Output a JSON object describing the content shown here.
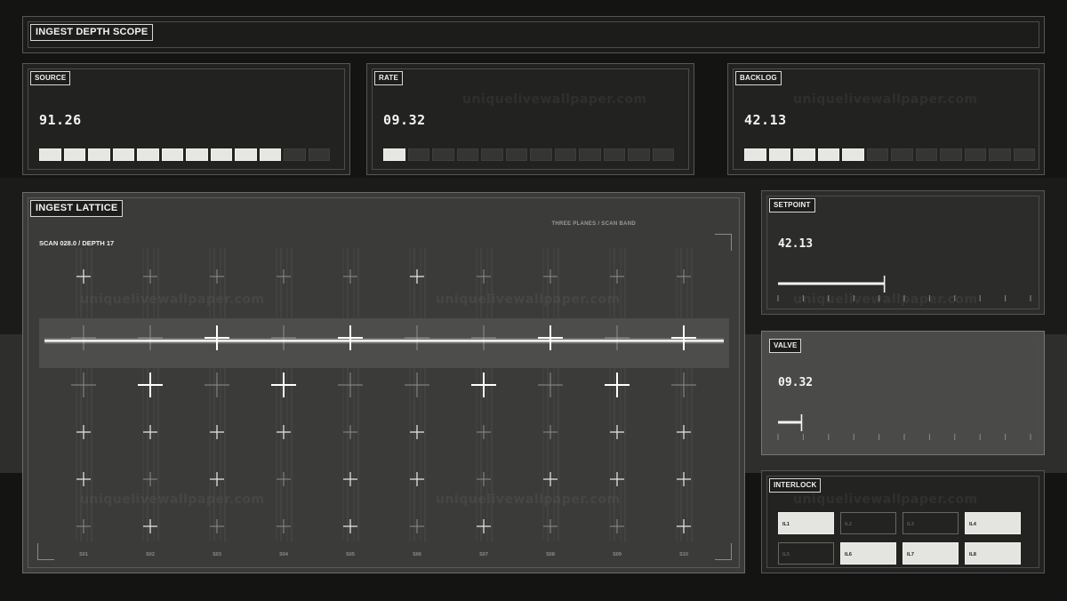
{
  "header": {
    "title": "INGEST DEPTH SCOPE"
  },
  "metrics": [
    {
      "label": "SOURCE",
      "value": "91.26",
      "bar": {
        "total": 12,
        "on": 10
      }
    },
    {
      "label": "RATE",
      "value": "09.32",
      "bar": {
        "total": 12,
        "on": 1
      }
    },
    {
      "label": "BACKLOG",
      "value": "42.13",
      "bar": {
        "total": 12,
        "on": 5
      }
    }
  ],
  "lattice": {
    "title": "INGEST LATTICE",
    "note": "THREE PLANES / SCAN BAND",
    "scan": "SCAN 028.0 / DEPTH 17",
    "columns": [
      "S01",
      "S02",
      "S03",
      "S04",
      "S05",
      "S06",
      "S07",
      "S08",
      "S09",
      "S10"
    ],
    "rows": 6,
    "highlight_row": 1,
    "scan_position": 0.195
  },
  "setpoint": {
    "label": "SETPOINT",
    "value": "42.13",
    "fraction": 0.4213,
    "ticks": 11
  },
  "valve": {
    "label": "VALVE",
    "value": "09.32",
    "fraction": 0.0932,
    "ticks": 11
  },
  "interlock": {
    "label": "INTERLOCK",
    "items": [
      {
        "name": "IL1",
        "on": true
      },
      {
        "name": "IL2",
        "on": false
      },
      {
        "name": "IL3",
        "on": false
      },
      {
        "name": "IL4",
        "on": true
      },
      {
        "name": "IL5",
        "on": false
      },
      {
        "name": "IL6",
        "on": true
      },
      {
        "name": "IL7",
        "on": true
      },
      {
        "name": "IL8",
        "on": true
      }
    ]
  },
  "watermark": "uniquelivewallpaper.com",
  "colors": {
    "accent": "#f0f0ee",
    "panel": "#222321",
    "lattice_bg": "#3b3c3a",
    "off": "#353634"
  }
}
